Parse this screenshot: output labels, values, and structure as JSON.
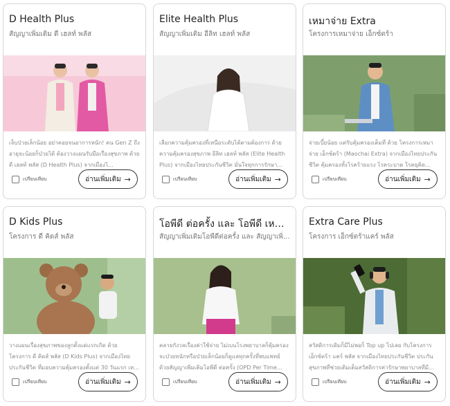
{
  "cards": [
    {
      "title": "D Health Plus",
      "subtitle": "สัญญาเพิ่มเติม ดี เฮลท์ พลัส",
      "description": "เจ็บป่วยเล็กน้อย อย่าคอยจนอาการหนัก! คน Gen Z ถึงอายุจะน้อยก็ป่วยได้ ต้องวางแผนรับมือเรื่องสุขภาพ ด้วย ดี เฮลท์ พลัส (D Health Plus) จากเมืองไ...",
      "compare_label": "เปรียบเทียบ",
      "readmore_label": "อ่านเพิ่มเติม"
    },
    {
      "title": "Elite Health Plus",
      "subtitle": "สัญญาเพิ่มเติม อีลิท เฮลท์ พลัส",
      "description": "เลือกความคุ้มครองที่เหนือระดับได้ตามต้องการ ด้วยความคุ้มครองสุขภาพ อีลิท เฮลท์ พลัส (Elite Health Plus) จากเมืองไทยประกันชีวิต มั่นใจทุกการรักษา...",
      "compare_label": "เปรียบเทียบ",
      "readmore_label": "อ่านเพิ่มเติม"
    },
    {
      "title": "เหมาจ่าย Extra",
      "subtitle": "โครงการเหมาจ่าย เอ็กซ์ตร้า",
      "description": "จ่ายเบี้ยน้อย แต่รับคุ้มครองเต็มที่ ด้วย โครงการเหมาจ่าย เอ็กซ์ตร้า (Maochai Extra) จากเมืองไทยประกันชีวิต คุ้มครองทั้งโรคร้ายแรง โรคระบาด โรคยุติดใหม่...",
      "compare_label": "เปรียบเทียบ",
      "readmore_label": "อ่านเพิ่มเติม"
    },
    {
      "title": "D Kids Plus",
      "subtitle": "โครงการ ดี คิดส์ พลัส",
      "description": "วางแผนเรื่องสุขภาพของลูกตั้งแต่แรกเกิด ด้วย โครงการ ดี คิดส์ พลัส (D Kids Plus) จากเมืองไทยประกันชีวิต ที่มอบความคุ้มครองตั้งแต่ 30 วันแรก เหมาจ่ายไม...",
      "compare_label": "เปรียบเทียบ",
      "readmore_label": "อ่านเพิ่มเติม"
    },
    {
      "title": "โอพีดี ต่อครั้ง และ โอพีดี เหมาจ่าย",
      "subtitle": "สัญญาเพิ่มเติมโอพีดีต่อครั้ง และ สัญญาเพิ่...",
      "description": "คลายกังวลเรื่องค่าใช้จ่าย ไม่เบนโรงพยาบาลก็คุ้มครองจะป่วยหนักหรือป่วยเล็กน้อยก็ดูแลทุกครั้งที่พบแพทย์ ด้วยสัญญาเพิ่มเติมโอพีดี ต่อครั้ง (OPD Per Time...",
      "compare_label": "เปรียบเทียบ",
      "readmore_label": "อ่านเพิ่มเติม"
    },
    {
      "title": "Extra Care Plus",
      "subtitle": "โครงการ เอ็กซ์ตร้าแคร์ พลัส",
      "description": "สวัสดิการเดิมก็มีไม่พอก็ Top up โปเลย กับโครงการ เอ็กซ์ตร้า แคร์ พลัส จากเมืองไทยประกันชีวิต ประกันสุขภาพที่ช่วยเติมเต็มสวัสดิการค่ารักษาพยาบาลที่มี...",
      "compare_label": "เปรียบเทียบ",
      "readmore_label": "อ่านเพิ่มเติม"
    }
  ]
}
